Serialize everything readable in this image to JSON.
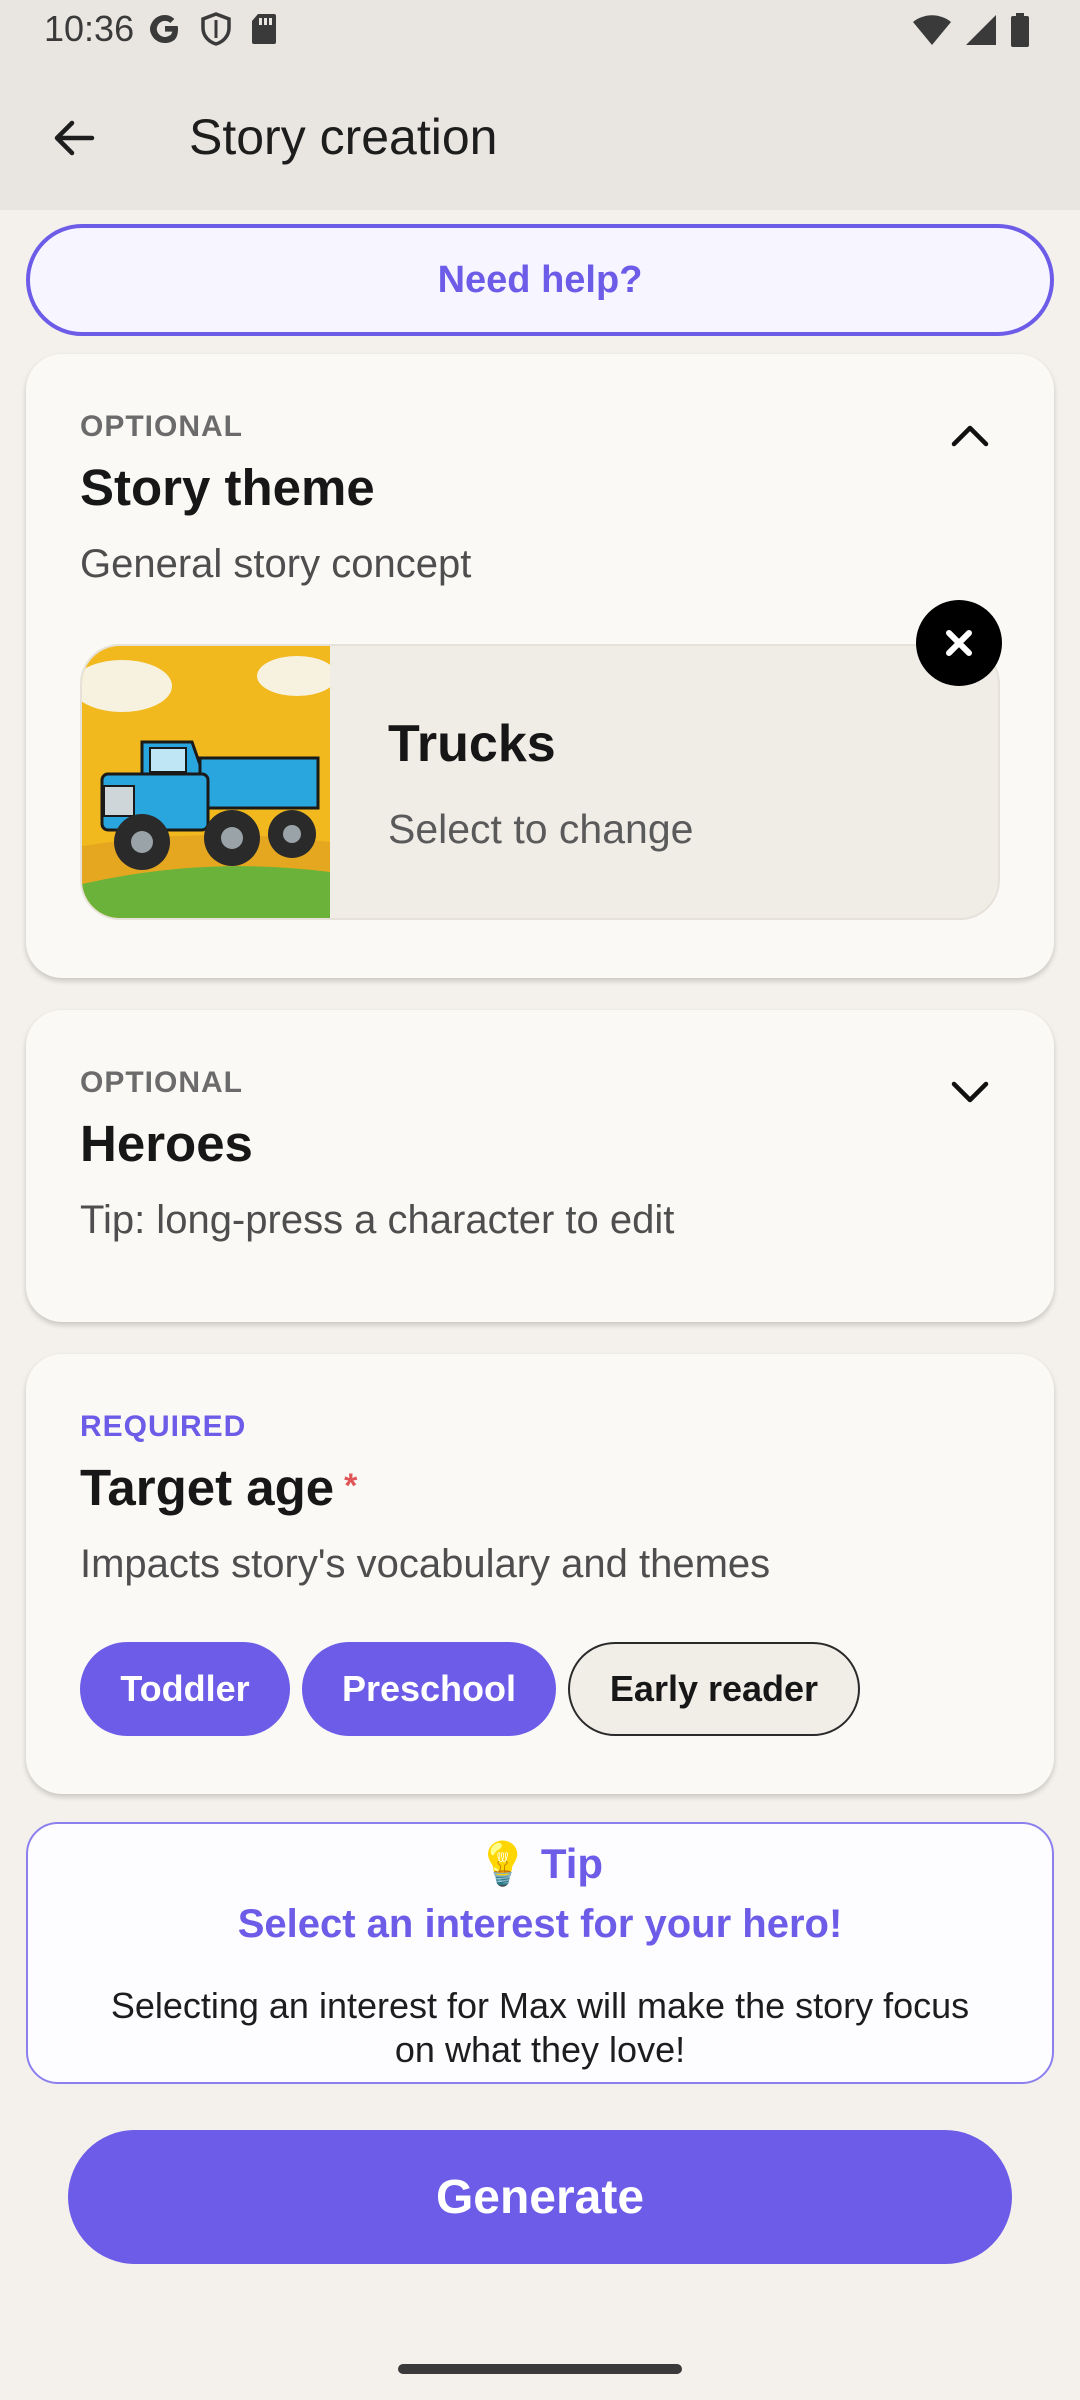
{
  "status_bar": {
    "time": "10:36",
    "icons": [
      "google-icon",
      "shield-icon",
      "sd-card-icon",
      "wifi-icon",
      "signal-icon",
      "battery-icon"
    ]
  },
  "app_bar": {
    "title": "Story creation",
    "back_icon": "arrow-left-icon"
  },
  "help_button": {
    "label": "Need help?"
  },
  "theme_card": {
    "eyebrow": "OPTIONAL",
    "title": "Story theme",
    "subtitle": "General story concept",
    "expanded": true,
    "selected": {
      "name": "Trucks",
      "hint": "Select to change"
    }
  },
  "heroes_card": {
    "eyebrow": "OPTIONAL",
    "title": "Heroes",
    "subtitle": "Tip: long-press a character to edit",
    "expanded": false
  },
  "age_card": {
    "eyebrow": "REQUIRED",
    "title": "Target age",
    "required_mark": "*",
    "subtitle": "Impacts story's vocabulary and themes",
    "options": [
      {
        "label": "Toddler",
        "selected": true
      },
      {
        "label": "Preschool",
        "selected": true
      },
      {
        "label": "Early reader",
        "selected": false
      }
    ]
  },
  "tip": {
    "emoji": "💡",
    "heading": "Tip",
    "title": "Select an interest for your hero!",
    "text": "Selecting an interest for Max will make the story focus on what they love!"
  },
  "generate_button": {
    "label": "Generate"
  },
  "colors": {
    "accent": "#6c5ce7",
    "background": "#f4f1ec",
    "card": "#faf9f6",
    "required_star": "#e05656"
  }
}
